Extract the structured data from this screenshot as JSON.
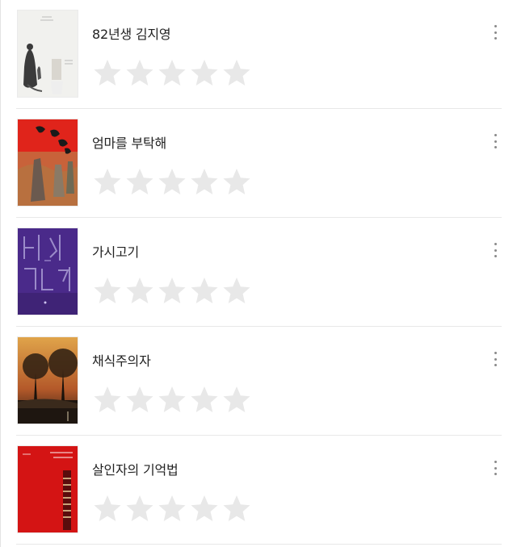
{
  "books": [
    {
      "title": "82년생 김지영",
      "rating": 0,
      "cover": "82년생 김지영",
      "menu_icon": "more-vertical-icon"
    },
    {
      "title": "엄마를 부탁해",
      "rating": 0,
      "cover": "엄마를 부탁해",
      "menu_icon": "more-vertical-icon"
    },
    {
      "title": "가시고기",
      "rating": 0,
      "cover": "가시고기",
      "menu_icon": "more-vertical-icon"
    },
    {
      "title": "채식주의자",
      "rating": 0,
      "cover": "채식주의자",
      "menu_icon": "more-vertical-icon"
    },
    {
      "title": "살인자의 기억법",
      "rating": 0,
      "cover": "살인자의 기억법",
      "menu_icon": "more-vertical-icon"
    }
  ],
  "rating_scale": 5,
  "colors": {
    "star_empty": "#e8e8e8",
    "title_text": "#222222",
    "menu_dots": "#8a8a8a",
    "divider": "#e8e8e8"
  }
}
